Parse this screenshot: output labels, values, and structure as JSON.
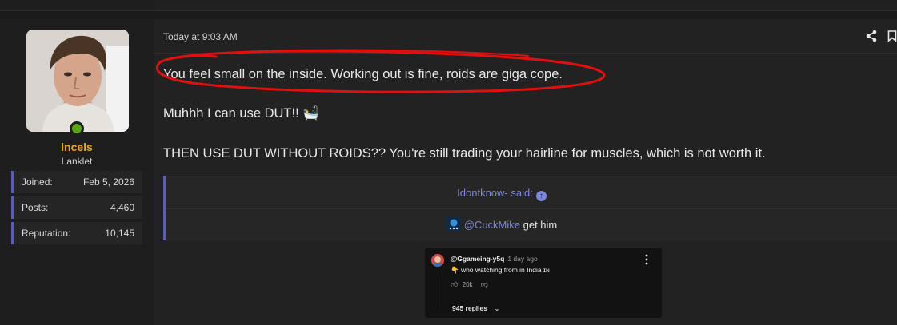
{
  "user": {
    "name": "lncels",
    "title": "Lanklet",
    "stats": [
      {
        "label": "Joined:",
        "value": "Feb 5, 2026"
      },
      {
        "label": "Posts:",
        "value": "4,460"
      },
      {
        "label": "Reputation:",
        "value": "10,145"
      }
    ]
  },
  "post": {
    "date": "Today at 9:03 AM",
    "lines": [
      "You feel small on the inside. Working out is fine, roids are giga cope.",
      "Muhhh I can use DUT!! 🛀",
      "THEN USE DUT WITHOUT ROIDS?? You're still trading your hairline for muscles, which is not worth it."
    ],
    "quote": {
      "author_said": "Idontknow- said:",
      "mention": "@CuckMike",
      "body_rest": " get him"
    },
    "embed": {
      "username": "@Ggameing-y5q",
      "time": "1 day ago",
      "text": "👇 who watching from in India ɪɴ",
      "likes": "20k",
      "replies": "945 replies"
    }
  },
  "colors": {
    "username": "#f0a020",
    "accent": "#5a5fb5",
    "online": "#58a618",
    "annotation": "#e01010"
  }
}
